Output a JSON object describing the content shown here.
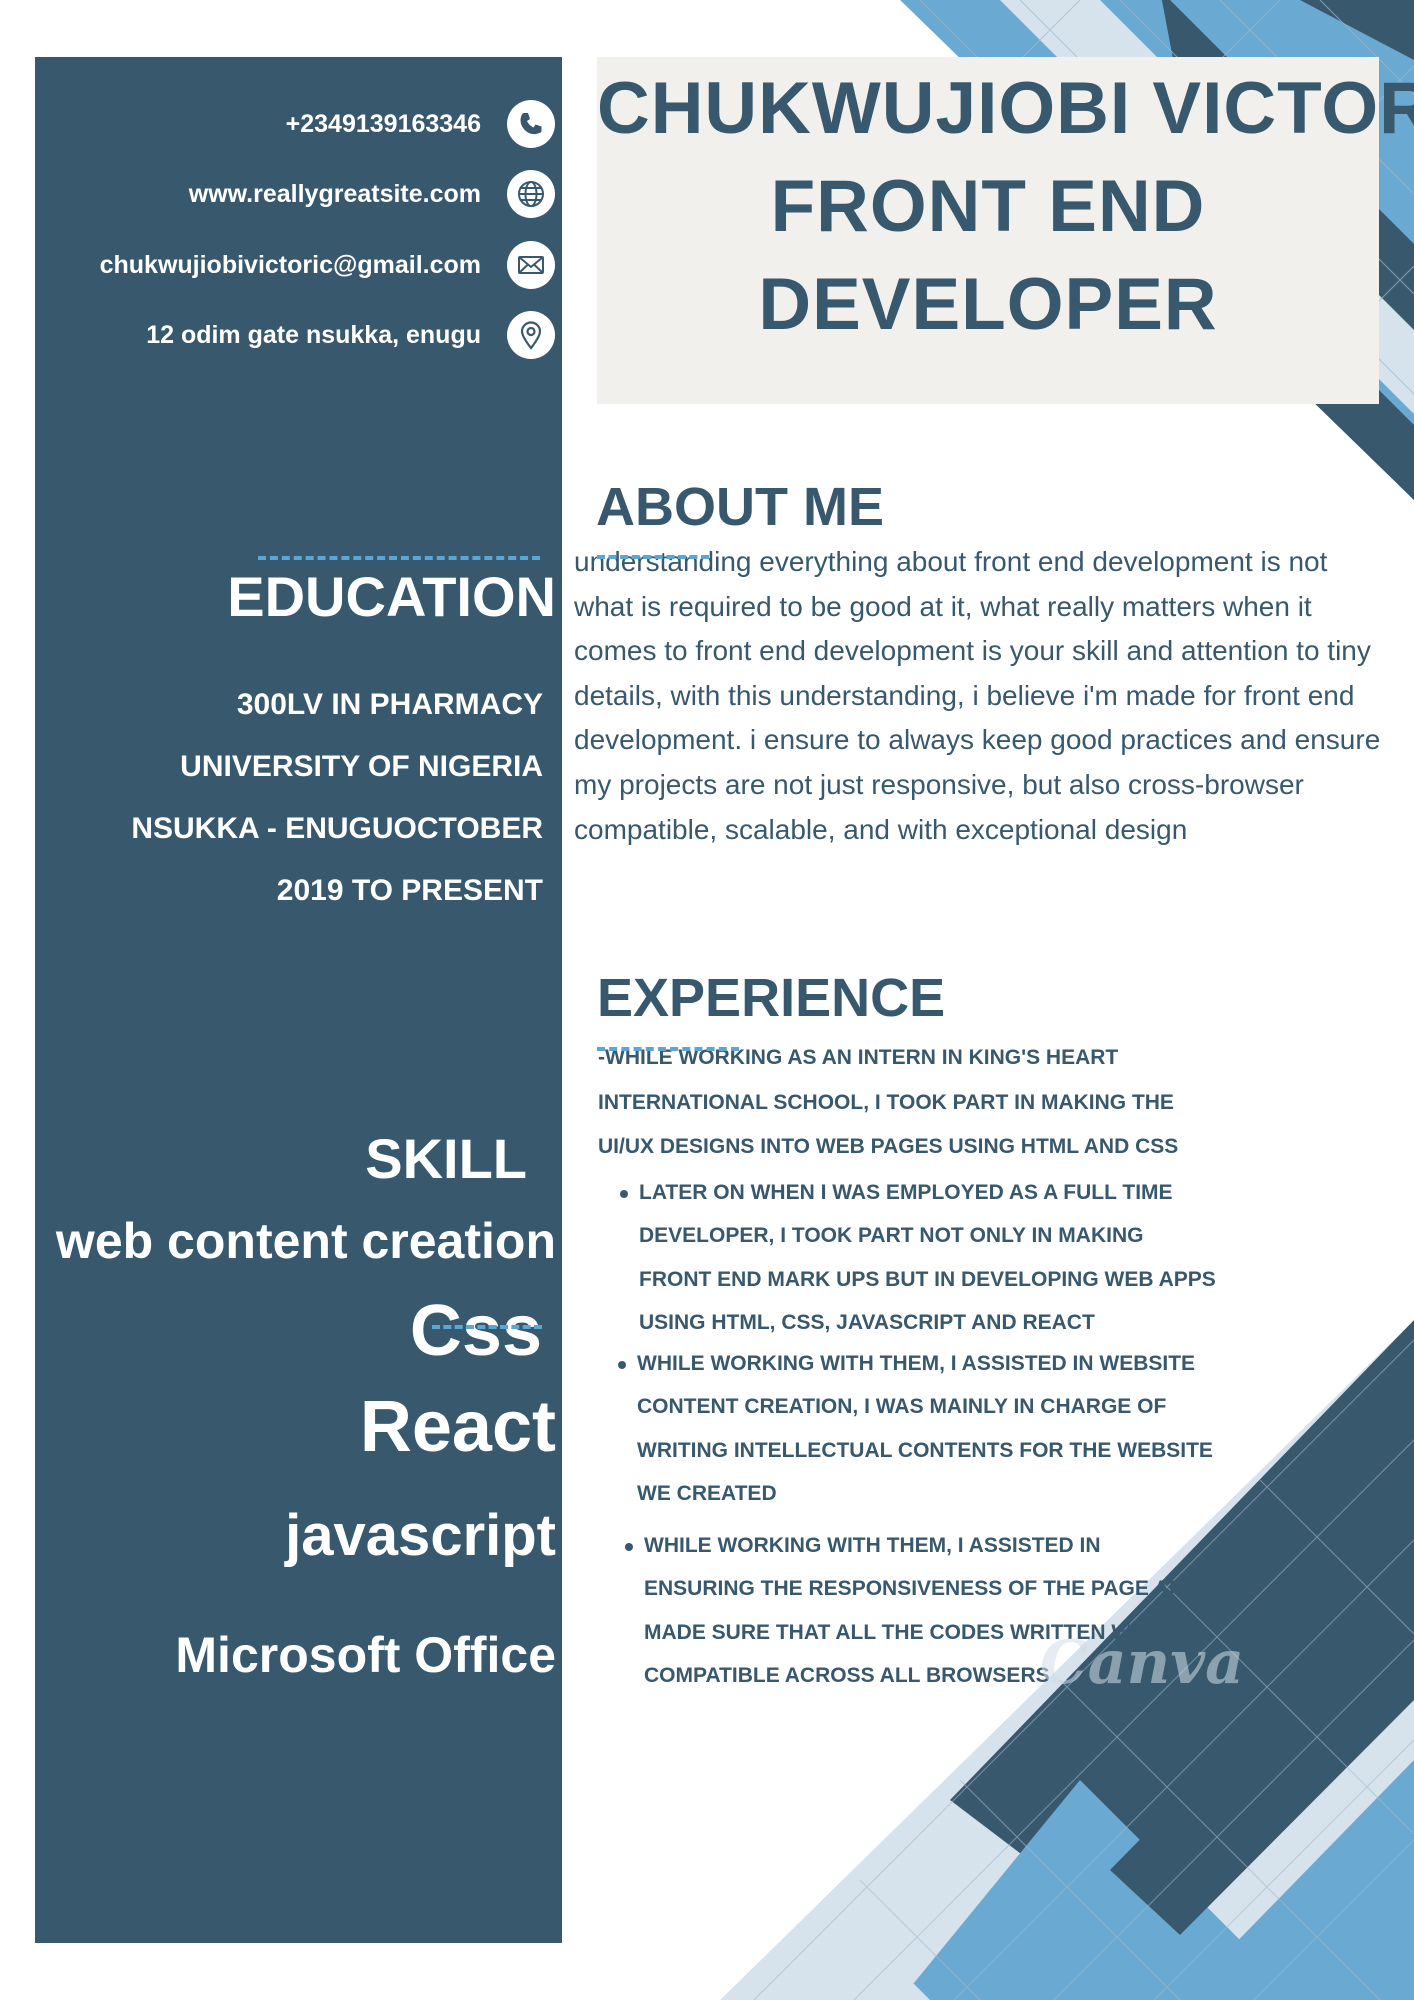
{
  "colors": {
    "sidebar": "#38596d",
    "accent_dark": "#38596d",
    "accent_light": "#6aaad2",
    "accent_pale": "#d6e2ec",
    "title_box": "#f1f0ed"
  },
  "contact": [
    {
      "text": "+2349139163346",
      "icon": "phone-icon"
    },
    {
      "text": "www.reallygreatsite.com",
      "icon": "globe-icon"
    },
    {
      "text": "chukwujiobivictoric@gmail.com",
      "icon": "mail-icon"
    },
    {
      "text": "12 odim gate nsukka, enugu",
      "icon": "location-pin-icon"
    }
  ],
  "title": {
    "line1": "CHUKWUJIOBI VICTOR",
    "line2": "FRONT END",
    "line3": "DEVELOPER"
  },
  "education": {
    "heading": "EDUCATION",
    "lines": [
      "300LV IN PHARMACY",
      "UNIVERSITY OF NIGERIA",
      "NSUKKA - ENUGUOCTOBER",
      "2019 TO PRESENT"
    ]
  },
  "skill": {
    "heading": "SKILL",
    "items": [
      "web content creation",
      "Css",
      "React",
      "javascript",
      "Microsoft Office"
    ]
  },
  "about": {
    "heading": "ABOUT ME",
    "lines": [
      "understanding everything about front end development is not",
      "what is required to be good at it, what really matters when it",
      "comes to front end development is your skill and attention to tiny",
      "details, with this understanding, i believe i'm made for front end",
      "development. i ensure to always keep good practices and ensure",
      "my projects are not just responsive, but also cross-browser",
      "compatible, scalable, and with exceptional design"
    ]
  },
  "experience": {
    "heading": "EXPERIENCE",
    "intro_lines": [
      "-WHILE WORKING AS AN INTERN IN KING'S HEART",
      "INTERNATIONAL SCHOOL, I TOOK PART IN MAKING THE",
      "UI/UX DESIGNS INTO WEB PAGES USING HTML AND CSS"
    ],
    "bullets": [
      {
        "lines": [
          "LATER ON WHEN I WAS EMPLOYED AS A FULL TIME",
          "DEVELOPER, I TOOK PART NOT ONLY IN MAKING",
          "FRONT END MARK UPS BUT IN DEVELOPING WEB APPS",
          "USING HTML, CSS, JAVASCRIPT AND REACT"
        ]
      },
      {
        "lines": [
          "WHILE WORKING WITH THEM, I ASSISTED IN WEBSITE",
          "CONTENT CREATION, I WAS MAINLY IN CHARGE OF",
          "WRITING INTELLECTUAL CONTENTS FOR THE WEBSITE",
          "WE CREATED"
        ]
      },
      {
        "lines": [
          "WHILE WORKING WITH THEM, I ASSISTED IN",
          "ENSURING THE RESPONSIVENESS OF THE PAGE AND",
          "MADE SURE THAT ALL THE CODES WRITTEN WERE",
          "COMPATIBLE ACROSS ALL BROWSERS"
        ]
      }
    ]
  },
  "watermark": "Canva"
}
